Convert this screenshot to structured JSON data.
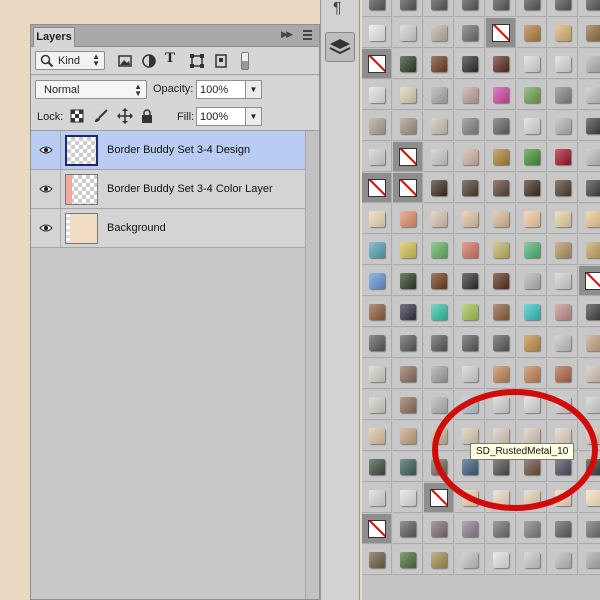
{
  "layers_panel": {
    "tab_label": "Layers",
    "filter_kind": "Kind",
    "blend_mode": "Normal",
    "opacity_label": "Opacity:",
    "opacity_value": "100%",
    "lock_label": "Lock:",
    "fill_label": "Fill:",
    "fill_value": "100%",
    "layers": [
      {
        "name": "Border Buddy Set 3-4  Design",
        "selected": true,
        "visible": true
      },
      {
        "name": "Border Buddy Set 3-4 Color Layer",
        "selected": false,
        "visible": true
      },
      {
        "name": "Background",
        "selected": false,
        "visible": true
      }
    ]
  },
  "dock": {
    "paragraph_icon": "¶"
  },
  "styles_grid": {
    "tooltip": "SD_RustedMetal_10",
    "columns": 8,
    "rows": 19,
    "tiles": [
      [
        "#555555",
        "#555555",
        "#555555",
        "#555555",
        "#555555",
        "#555555",
        "#555555",
        "#555555"
      ],
      [
        "#e8e8e8",
        "#cfcfcf",
        "#b8b0a0",
        "#6a6a6a",
        "none",
        "#b07a3a",
        "#d8b070",
        "#8a6a3a"
      ],
      [
        "none",
        "#2a3a22",
        "#6a3a1a",
        "#2a2a2a",
        "#5a2a1a",
        "#d8d8d8",
        "#d8d8d8",
        "#b0b0b0"
      ],
      [
        "#e0e0e0",
        "#d8d0b0",
        "#a8a8a8",
        "#c0a0a0",
        "#d040a0",
        "#6aa050",
        "#808080",
        "#c0c0c0"
      ],
      [
        "#a8a090",
        "#a09080",
        "#c8c0b0",
        "#808080",
        "#606060",
        "#d8d8d8",
        "#b0b0b0",
        "#3a3a3a"
      ],
      [
        "#d0d0d0",
        "none",
        "#c8c8c8",
        "#d0b0a0",
        "#a88030",
        "#409030",
        "#a01020",
        "#bbbbbb"
      ],
      [
        "none",
        "none",
        "#3a2a1a",
        "#4a3a2a",
        "#5a4030",
        "#3a2a1a",
        "#4a3a2a",
        "#3a3a3a"
      ],
      [
        "#e8d8b0",
        "#e08a6a",
        "#d8c0b0",
        "#e0c0a0",
        "#d8b890",
        "#f0c8a0",
        "#e8d0a0",
        "#e8c890"
      ],
      [
        "#50a0b0",
        "#d0c050",
        "#60b060",
        "#d07060",
        "#c0b060",
        "#50b070",
        "#b09060",
        "#c0a060"
      ],
      [
        "#6090d0",
        "#2a3a22",
        "#6a3a1a",
        "#2a2a2a",
        "#5a2a1a",
        "#b0b0b0",
        "#d0d0d0",
        "none"
      ],
      [
        "#8a5a3a",
        "#303040",
        "#30c0a0",
        "#a0c050",
        "#8a5a3a",
        "#30c0c0",
        "#c08a8a",
        "#3a3a3a"
      ],
      [
        "#555555",
        "#555555",
        "#555555",
        "#555555",
        "#555555",
        "#c08a40",
        "#c0c0c0",
        "#c0a080"
      ],
      [
        "#d0d0c0",
        "#8a6a5a",
        "#a0a0a0",
        "#d0d0d0",
        "#c08050",
        "#c08050",
        "#b06040",
        "#d0c0b0"
      ],
      [
        "#d0d0c0",
        "#8a6a5a",
        "#b0b0b0",
        "#b0c8d0",
        "#d0d0d0",
        "#d8d8d8",
        "#d0d0d0",
        "#d0d0d0"
      ],
      [
        "#d8c0a0",
        "#c0a080",
        "#c8b890",
        "#d8c8b0",
        "#d8c8b8",
        "#d8c8b8",
        "#e0d0c0",
        "#d8c8b8"
      ],
      [
        "#3a4a3a",
        "#3a5a5a",
        "#6a6a5a",
        "#3a5a7a",
        "#4a4a4a",
        "#6a4a3a",
        "#4a4a5a",
        "#3a3a3a"
      ],
      [
        "#d8d8d8",
        "#e0e0e0",
        "none",
        "#f0d0b0",
        "#f0d8c0",
        "#e8d0b8",
        "#f0d8c0",
        "#f8e0c0"
      ],
      [
        "none",
        "#5a5a5a",
        "#7a6a6a",
        "#8a7a8a",
        "#6a6a6a",
        "#7a7a7a",
        "#5a5a5a",
        "#6a6a6a"
      ],
      [
        "#6a5a3a",
        "#4a6a3a",
        "#a08a4a",
        "#c0c0c0",
        "#e0e0e0",
        "#c8c8c8",
        "#b8b8b8",
        "#a8a8a8"
      ]
    ]
  }
}
